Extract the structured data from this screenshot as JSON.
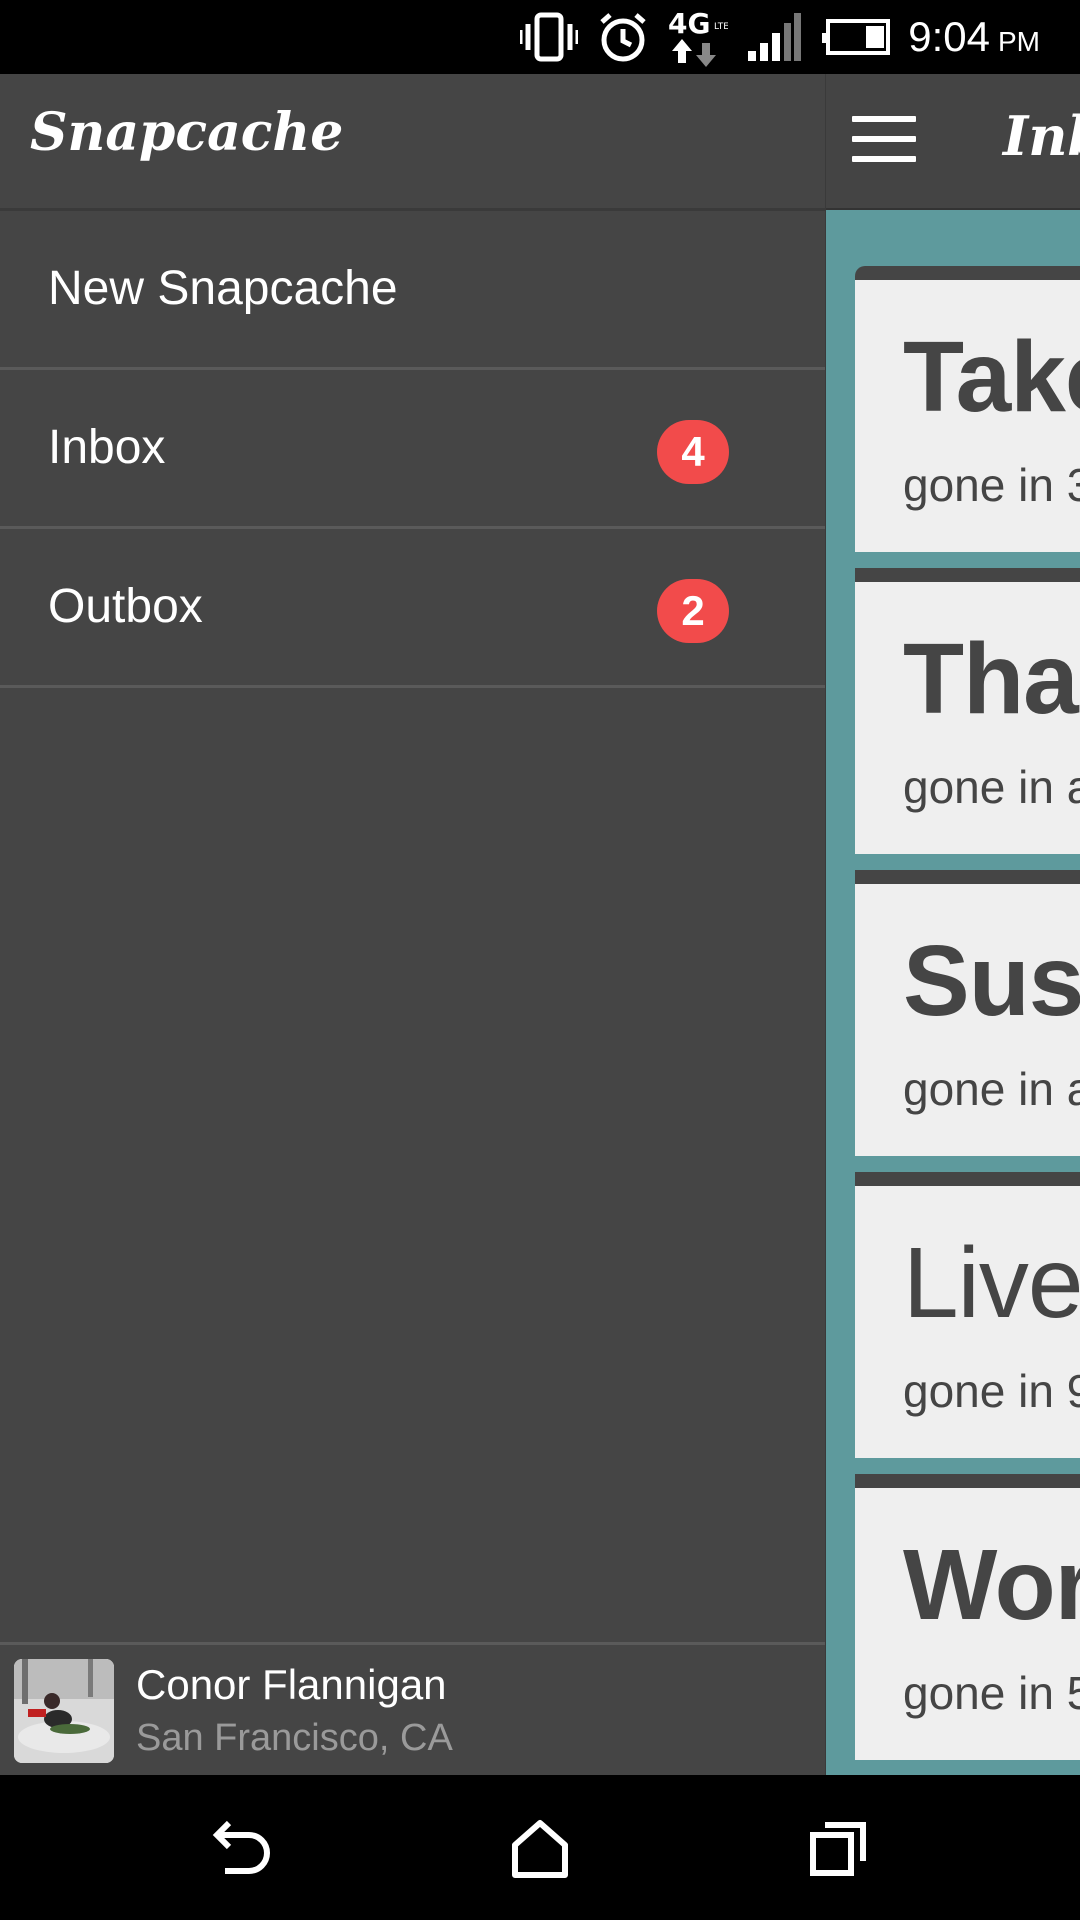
{
  "status_bar": {
    "time": "9:04",
    "ampm": "PM",
    "network_type": "4G LTE",
    "icons": [
      "vibrate-icon",
      "alarm-icon",
      "4g-lte-data-icon",
      "signal-icon",
      "battery-icon"
    ]
  },
  "app": {
    "title": "Inb",
    "accent_color": "#5e9a9d",
    "cards": [
      {
        "title": "Take",
        "subtitle": "gone in 3"
      },
      {
        "title": "Tha",
        "subtitle": "gone in a"
      },
      {
        "title": "Sush",
        "subtitle": "gone in a"
      },
      {
        "title": "Live",
        "subtitle": "gone in 9"
      },
      {
        "title": "Wor",
        "subtitle": "gone in 5"
      }
    ]
  },
  "drawer": {
    "logo": "Snapcache",
    "items": [
      {
        "label": "New Snapcache",
        "badge": ""
      },
      {
        "label": "Inbox",
        "badge": "4"
      },
      {
        "label": "Outbox",
        "badge": "2"
      }
    ],
    "badge_color": "#f24b4b",
    "profile": {
      "name": "Conor Flannigan",
      "location": "San Francisco, CA"
    }
  },
  "nav_bar": {
    "buttons": [
      "back-icon",
      "home-icon",
      "recent-apps-icon"
    ]
  }
}
